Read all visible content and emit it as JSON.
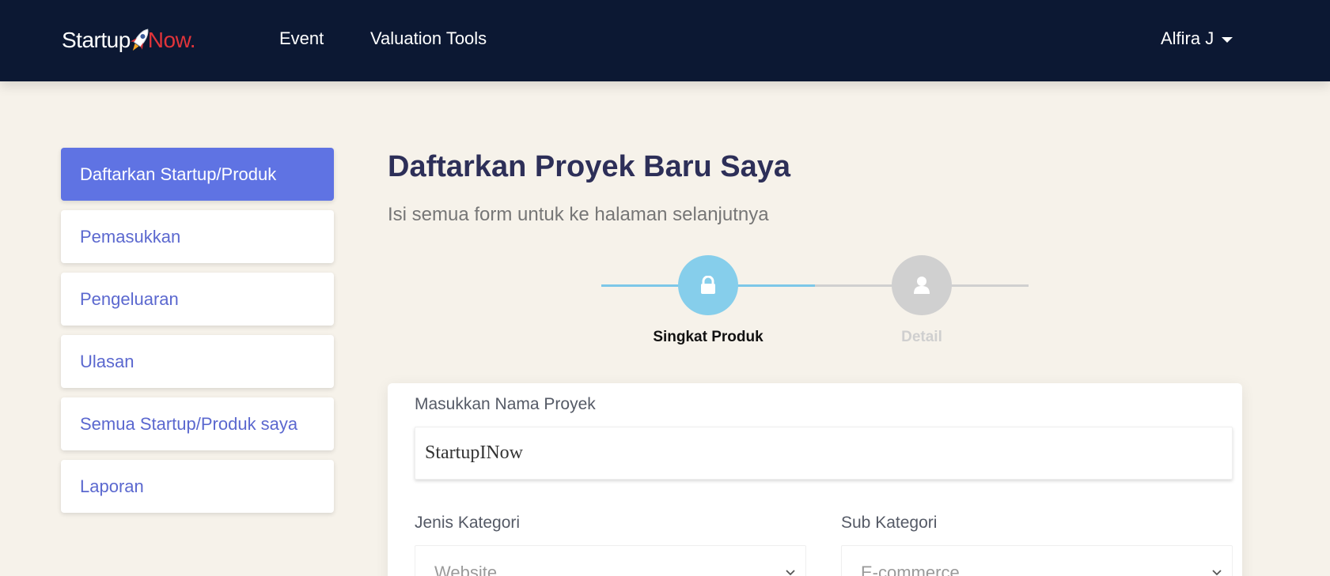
{
  "brand": {
    "part1": "Startup",
    "part2": "Now.",
    "colors": {
      "navbar": "#0c1833",
      "brand_red": "#e0343a",
      "accent": "#5f73e3",
      "step_active": "#86ceeb"
    }
  },
  "nav": {
    "event": "Event",
    "valuation_tools": "Valuation Tools",
    "user": "Alfira J"
  },
  "sidebar": {
    "items": [
      {
        "label": "Daftarkan Startup/Produk",
        "active": true
      },
      {
        "label": "Pemasukkan"
      },
      {
        "label": "Pengeluaran"
      },
      {
        "label": "Ulasan"
      },
      {
        "label": "Semua Startup/Produk saya"
      },
      {
        "label": "Laporan"
      }
    ]
  },
  "main": {
    "title": "Daftarkan Proyek Baru Saya",
    "subtitle": "Isi semua form untuk ke halaman selanjutnya"
  },
  "stepper": {
    "steps": [
      {
        "label": "Singkat Produk",
        "icon": "lock-icon",
        "active": true
      },
      {
        "label": "Detail",
        "icon": "user-icon",
        "active": false
      }
    ]
  },
  "form": {
    "nama_label": "Masukkan Nama Proyek",
    "nama_value": "StartupINow",
    "jenis_label": "Jenis Kategori",
    "jenis_value": "Website",
    "sub_label": "Sub Kategori",
    "sub_value": "E-commerce"
  }
}
